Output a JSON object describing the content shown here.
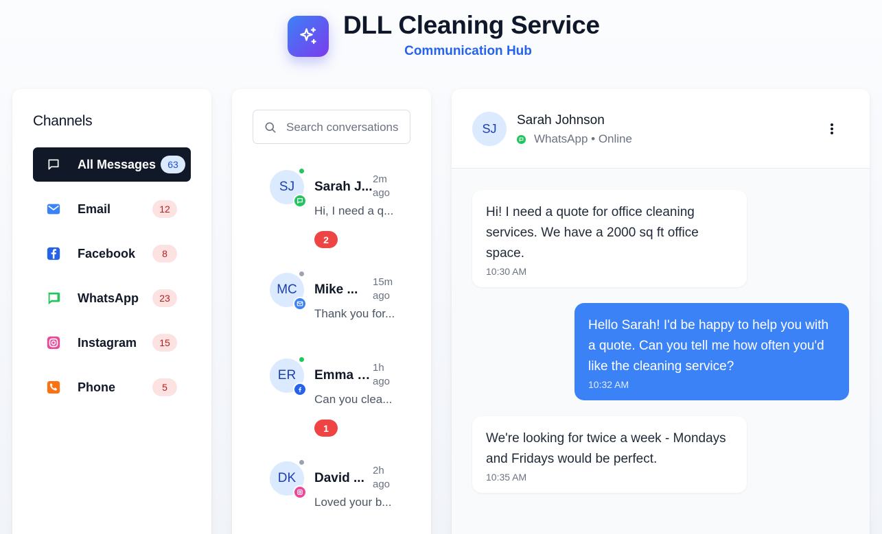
{
  "app": {
    "title": "DLL Cleaning Service",
    "subtitle": "Communication Hub"
  },
  "channels": {
    "heading": "Channels",
    "items": [
      {
        "label": "All Messages",
        "count": "63",
        "icon": "message-square-icon",
        "active": true
      },
      {
        "label": "Email",
        "count": "12",
        "icon": "mail-icon"
      },
      {
        "label": "Facebook",
        "count": "8",
        "icon": "facebook-icon"
      },
      {
        "label": "WhatsApp",
        "count": "23",
        "icon": "whatsapp-icon"
      },
      {
        "label": "Instagram",
        "count": "15",
        "icon": "instagram-icon"
      },
      {
        "label": "Phone",
        "count": "5",
        "icon": "phone-icon"
      }
    ]
  },
  "search": {
    "placeholder": "Search conversations"
  },
  "conversations": [
    {
      "initials": "SJ",
      "name": "Sarah J...",
      "time": "2m ago",
      "preview": "Hi, I need a q...",
      "unread": "2",
      "status": "online",
      "channel": "whatsapp"
    },
    {
      "initials": "MC",
      "name": "Mike ...",
      "time": "15m ago",
      "preview": "Thank you for...",
      "unread": "",
      "status": "offline",
      "channel": "email"
    },
    {
      "initials": "ER",
      "name": "Emma R...",
      "time": "1h ago",
      "preview": "Can you clea...",
      "unread": "1",
      "status": "online",
      "channel": "facebook"
    },
    {
      "initials": "DK",
      "name": "David ...",
      "time": "2h ago",
      "preview": "Loved your b...",
      "unread": "",
      "status": "offline",
      "channel": "instagram"
    }
  ],
  "chat": {
    "contact": {
      "initials": "SJ",
      "name": "Sarah Johnson",
      "status": "WhatsApp • Online"
    },
    "messages": [
      {
        "direction": "in",
        "text": "Hi! I need a quote for office cleaning services. We have a 2000 sq ft office space.",
        "time": "10:30 AM"
      },
      {
        "direction": "out",
        "text": "Hello Sarah! I'd be happy to help you with a quote. Can you tell me how often you'd like the cleaning service?",
        "time": "10:32 AM"
      },
      {
        "direction": "in",
        "text": "We're looking for twice a week - Mondays and Fridays would be perfect.",
        "time": "10:35 AM"
      }
    ]
  },
  "colors": {
    "accent": "#3b82f6",
    "brand_gradient_start": "#3b82f6",
    "brand_gradient_end": "#7c3aed",
    "active_channel_bg": "#111827",
    "unread_badge": "#ef4444",
    "online": "#22c55e",
    "offline": "#9ca3af"
  }
}
